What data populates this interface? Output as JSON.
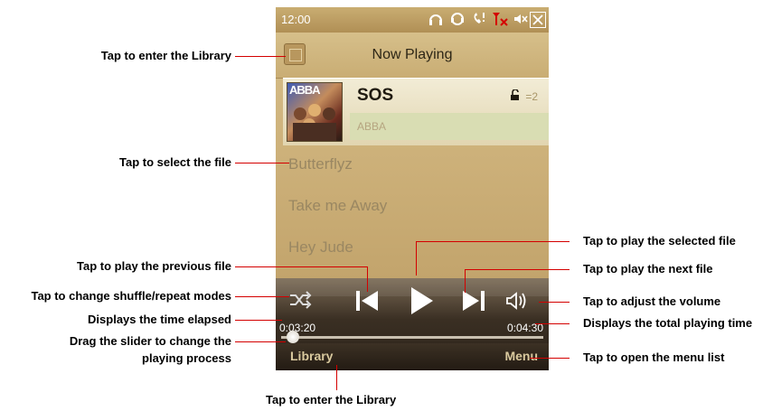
{
  "status_bar": {
    "time": "12:00",
    "icons": [
      "headphones-icon",
      "headset-icon",
      "phone-icon",
      "no-signal-icon",
      "mute-icon",
      "close-icon"
    ]
  },
  "title_bar": {
    "title": "Now Playing"
  },
  "now_playing": {
    "album_art_text": "ABBA",
    "song": "SOS",
    "artist": "ABBA",
    "lock_count": "=2"
  },
  "playlist": [
    "Butterflyz",
    "Take me Away",
    "Hey Jude"
  ],
  "controls": {
    "elapsed": "0:03:20",
    "total": "0:04:30",
    "progress_fraction": 0.02
  },
  "softkeys": {
    "left": "Library",
    "right": "Menu"
  },
  "callouts": {
    "library_icon": "Tap to enter the Library",
    "select_file": "Tap to select the file",
    "previous": "Tap to play the previous file",
    "shuffle": "Tap to change shuffle/repeat modes",
    "elapsed": "Displays the time elapsed",
    "slider_line1": "Drag the slider to change the",
    "slider_line2": "playing process",
    "play": "Tap to play the selected file",
    "next": "Tap to play the next file",
    "volume": "Tap to adjust the volume",
    "total": "Displays the total playing time",
    "menu": "Tap to open the menu list",
    "library_softkey": "Tap to enter the Library"
  },
  "colors": {
    "callout_line": "#d40000"
  }
}
